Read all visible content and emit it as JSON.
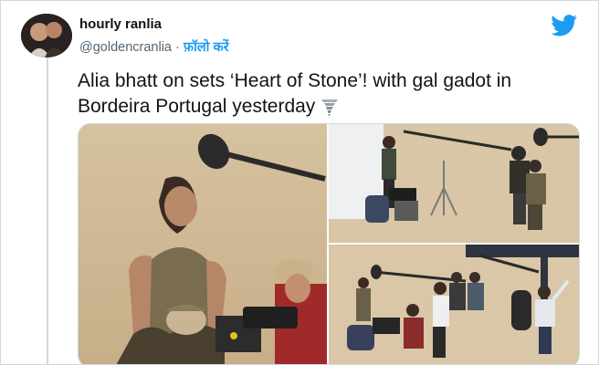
{
  "author": {
    "display_name": "hourly ranlia",
    "handle": "@goldencranlia",
    "separator": "·",
    "follow_label": "फ़ॉलो करें"
  },
  "tweet": {
    "text": "Alia bhatt on sets ‘Heart of Stone’! with gal gadot in Bordeira Portugal yesterday"
  },
  "icons": {
    "brand": "twitter-bird-icon",
    "emoji": "tornado-icon"
  },
  "colors": {
    "accent": "#1d9bf0",
    "text": "#0f1419",
    "secondary_text": "#536471",
    "border": "#cfd9de"
  }
}
